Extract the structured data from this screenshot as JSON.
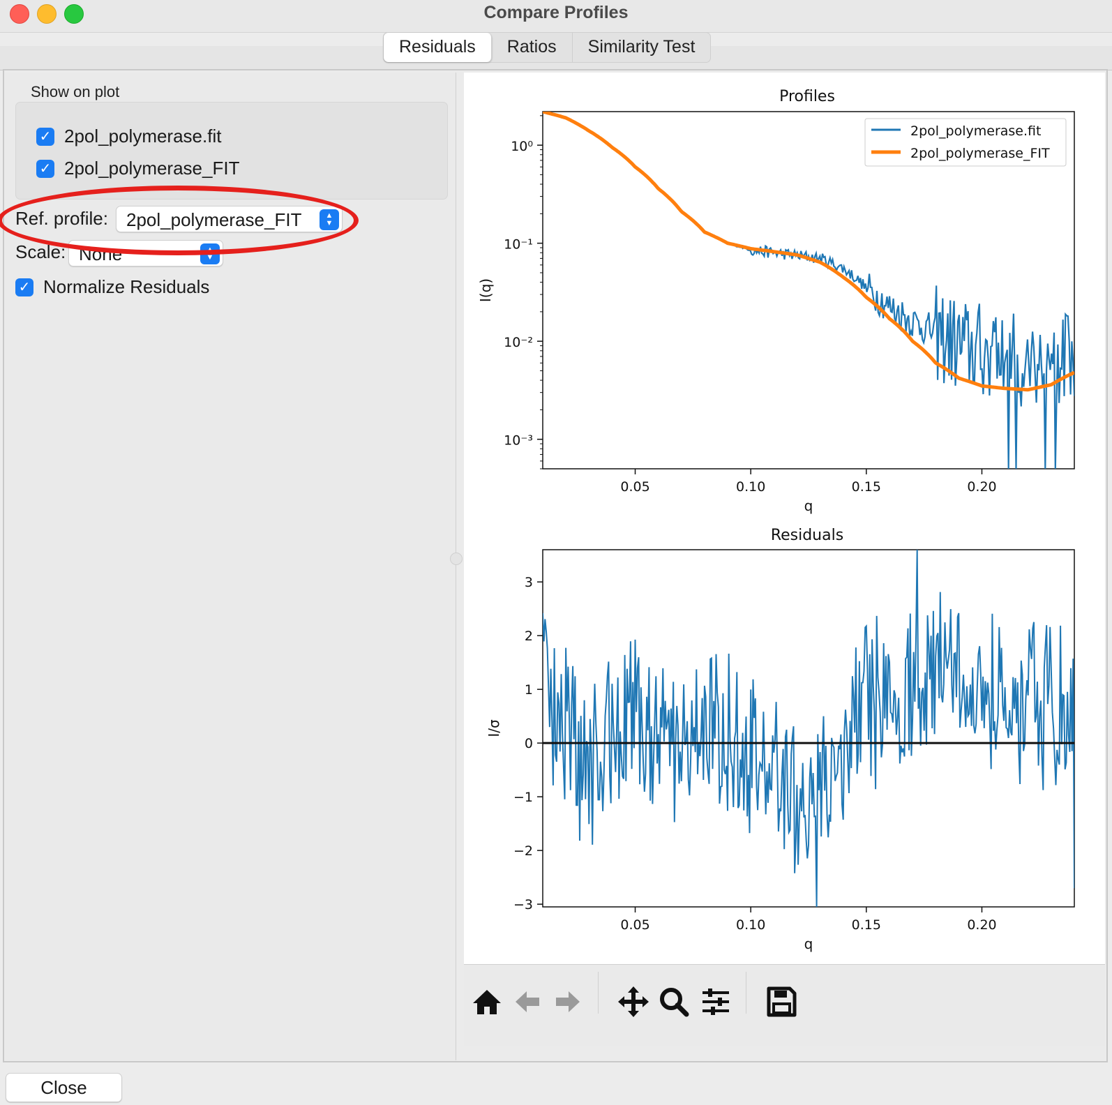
{
  "window": {
    "title": "Compare Profiles"
  },
  "tabs": [
    {
      "label": "Residuals",
      "active": true
    },
    {
      "label": "Ratios",
      "active": false
    },
    {
      "label": "Similarity Test",
      "active": false
    }
  ],
  "left_panel": {
    "group_label": "Show on plot",
    "checkboxes": [
      {
        "label": "2pol_polymerase.fit",
        "checked": true
      },
      {
        "label": "2pol_polymerase_FIT",
        "checked": true
      }
    ],
    "ref_profile": {
      "label": "Ref. profile:",
      "value": "2pol_polymerase_FIT"
    },
    "scale": {
      "label": "Scale:",
      "value": "None"
    },
    "normalize": {
      "label": "Normalize Residuals",
      "checked": true
    }
  },
  "close_label": "Close",
  "toolbar_icons": [
    "home-icon",
    "back-arrow-icon",
    "forward-arrow-icon",
    "pan-icon",
    "zoom-icon",
    "configure-icon",
    "save-icon"
  ],
  "annotation": {
    "shape": "ellipse",
    "color": "#e5201c",
    "target": "ref-profile"
  },
  "chart_data": [
    {
      "type": "line",
      "title": "Profiles",
      "xlabel": "q",
      "ylabel": "I(q)",
      "xlim": [
        0.01,
        0.24
      ],
      "ylim": [
        0.0005,
        2.2
      ],
      "yscale": "log",
      "x_ticks": [
        "0.05",
        "0.10",
        "0.15",
        "0.20"
      ],
      "y_ticks": [
        "10⁰",
        "10⁻¹",
        "10⁻²",
        "10⁻³"
      ],
      "legend": "top-right",
      "series": [
        {
          "name": "2pol_polymerase.fit",
          "color": "#1f77b4",
          "x": [
            0.01,
            0.02,
            0.03,
            0.04,
            0.05,
            0.06,
            0.07,
            0.08,
            0.09,
            0.1,
            0.11,
            0.12,
            0.13,
            0.14,
            0.15,
            0.16,
            0.17,
            0.18,
            0.19,
            0.2,
            0.21,
            0.22,
            0.23,
            0.24
          ],
          "y": [
            2.2,
            1.9,
            1.4,
            0.95,
            0.6,
            0.36,
            0.21,
            0.13,
            0.1,
            0.085,
            0.08,
            0.075,
            0.07,
            0.055,
            0.035,
            0.022,
            0.016,
            0.012,
            0.009,
            0.008,
            0.007,
            0.006,
            0.007,
            0.006
          ]
        },
        {
          "name": "2pol_polymerase_FIT",
          "color": "#ff7f0e",
          "x": [
            0.01,
            0.02,
            0.03,
            0.04,
            0.05,
            0.06,
            0.07,
            0.08,
            0.09,
            0.1,
            0.11,
            0.12,
            0.13,
            0.14,
            0.15,
            0.16,
            0.17,
            0.18,
            0.19,
            0.2,
            0.21,
            0.22,
            0.23,
            0.24
          ],
          "y": [
            2.2,
            1.9,
            1.4,
            0.95,
            0.6,
            0.36,
            0.21,
            0.13,
            0.1,
            0.088,
            0.082,
            0.076,
            0.064,
            0.045,
            0.028,
            0.017,
            0.01,
            0.006,
            0.0042,
            0.0035,
            0.0033,
            0.0032,
            0.0036,
            0.0048
          ]
        }
      ]
    },
    {
      "type": "line",
      "title": "Residuals",
      "xlabel": "q",
      "ylabel": "I/σ",
      "xlim": [
        0.01,
        0.24
      ],
      "ylim": [
        -3.05,
        3.6
      ],
      "x_ticks": [
        "0.05",
        "0.10",
        "0.15",
        "0.20"
      ],
      "y_ticks": [
        "3",
        "2",
        "1",
        "0",
        "−1",
        "−2",
        "−3"
      ],
      "zero_line": true,
      "series": [
        {
          "color": "#1f77b4",
          "x": [
            0.01,
            0.02,
            0.03,
            0.04,
            0.05,
            0.06,
            0.07,
            0.08,
            0.09,
            0.1,
            0.11,
            0.12,
            0.13,
            0.14,
            0.15,
            0.16,
            0.17,
            0.18,
            0.19,
            0.2,
            0.21,
            0.22,
            0.23,
            0.24
          ],
          "y": [
            1.5,
            0.4,
            -0.5,
            0.3,
            0.6,
            -0.2,
            0.2,
            0.4,
            0.1,
            -0.6,
            -0.4,
            -0.9,
            -1.1,
            -0.3,
            0.7,
            0.8,
            0.9,
            1.2,
            1.1,
            0.8,
            0.7,
            0.9,
            0.6,
            0.4
          ],
          "y_max": 3.6,
          "y_min": -3.05
        }
      ]
    }
  ]
}
